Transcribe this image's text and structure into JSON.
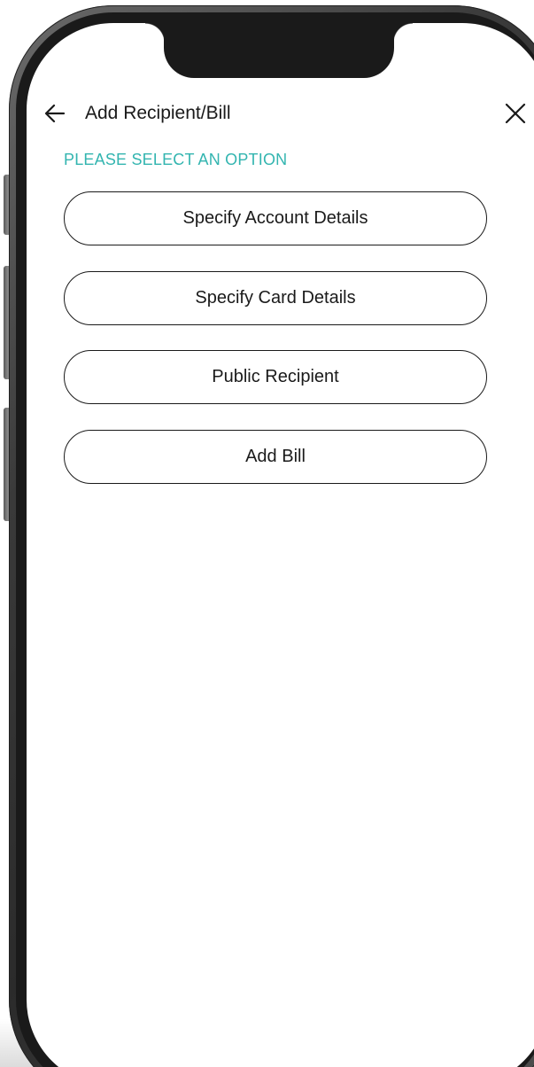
{
  "header": {
    "title": "Add Recipient/Bill",
    "back_icon": "arrow-left-icon",
    "close_icon": "close-icon"
  },
  "section_label": "PLEASE SELECT AN OPTION",
  "options": [
    {
      "label": "Specify Account Details"
    },
    {
      "label": "Specify Card Details"
    },
    {
      "label": "Public Recipient"
    },
    {
      "label": "Add Bill"
    }
  ],
  "colors": {
    "accent": "#33b5b0",
    "text": "#1a1a1a",
    "frame": "#2b2b2b"
  }
}
